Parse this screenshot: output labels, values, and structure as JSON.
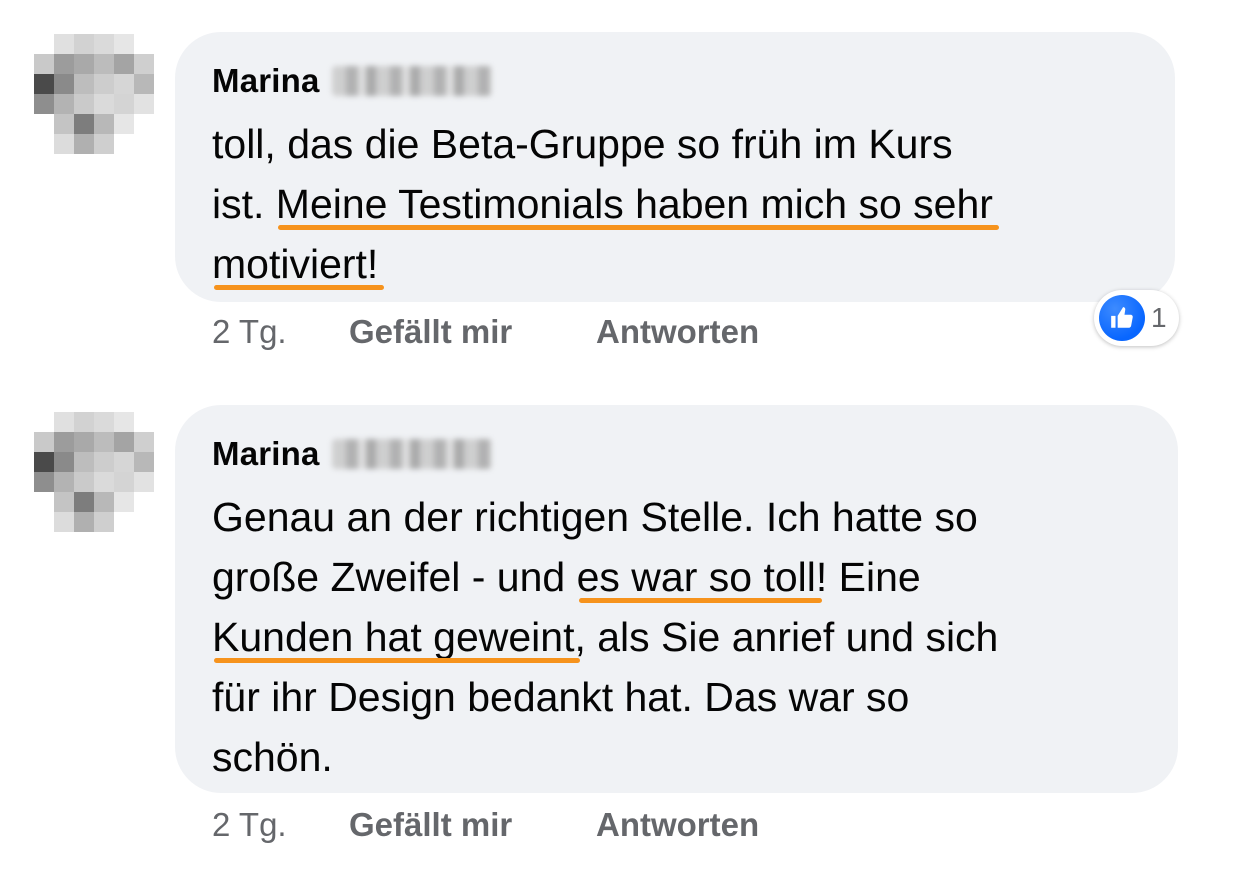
{
  "comments": [
    {
      "author": "Marina",
      "lines": [
        [
          {
            "t": "toll, das die Beta-Gruppe so früh im Kurs"
          }
        ],
        [
          {
            "t": "ist. "
          },
          {
            "t": "Meine Testimonials haben mich so sehr",
            "hl": true
          }
        ],
        [
          {
            "t": "motiviert!",
            "hl": true
          }
        ]
      ],
      "time": "2 Tg.",
      "like_label": "Gefällt mir",
      "reply_label": "Antworten",
      "reactions": {
        "icon": "thumbs-up-icon",
        "count": "1"
      }
    },
    {
      "author": "Marina",
      "lines": [
        [
          {
            "t": "Genau an der richtigen Stelle. Ich hatte so"
          }
        ],
        [
          {
            "t": "große Zweifel - und "
          },
          {
            "t": "es war so toll",
            "hl": true
          },
          {
            "t": "! Eine"
          }
        ],
        [
          {
            "t": "Kunden hat geweint",
            "hl": true
          },
          {
            "t": ", als Sie anrief und sich"
          }
        ],
        [
          {
            "t": "für ihr Design bedankt hat. Das war so"
          }
        ],
        [
          {
            "t": "schön."
          }
        ]
      ],
      "time": "2 Tg.",
      "like_label": "Gefällt mir",
      "reply_label": "Antworten"
    }
  ],
  "colors": {
    "bubble": "#f0f2f5",
    "highlight_underline": "#f6931d",
    "meta_text": "#65676b",
    "like_blue": "#0866ff"
  }
}
